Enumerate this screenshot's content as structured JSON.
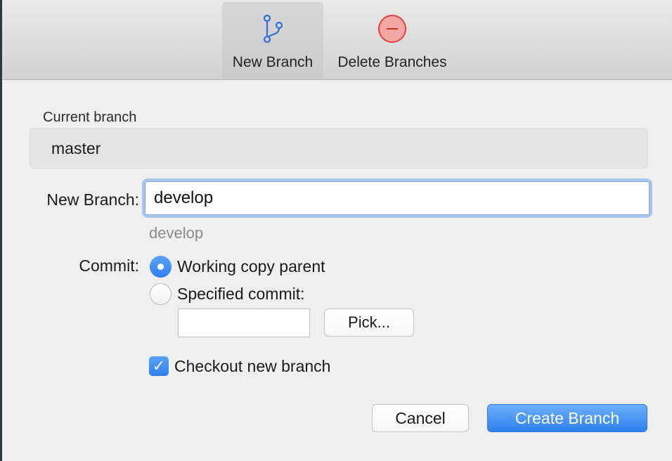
{
  "toolbar": {
    "new_branch_label": "New Branch",
    "delete_branches_label": "Delete Branches",
    "active_item": "New Branch",
    "icons": {
      "new_branch": "branch-icon",
      "delete_branches": "minus-circle-icon"
    }
  },
  "current_branch": {
    "label": "Current branch",
    "value": "master"
  },
  "new_branch": {
    "label": "New Branch:",
    "value": "develop",
    "preview": "develop"
  },
  "commit": {
    "label": "Commit:",
    "options": [
      {
        "label": "Working copy parent",
        "selected": true
      },
      {
        "label": "Specified commit:",
        "selected": false
      }
    ],
    "specified_commit_value": "",
    "pick_label": "Pick..."
  },
  "checkout": {
    "label": "Checkout new branch",
    "checked": true
  },
  "buttons": {
    "cancel": "Cancel",
    "create": "Create Branch"
  },
  "colors": {
    "accent": "#2f80ef",
    "focus_ring": "#a7c6ef",
    "delete_icon": "#e0413f"
  }
}
